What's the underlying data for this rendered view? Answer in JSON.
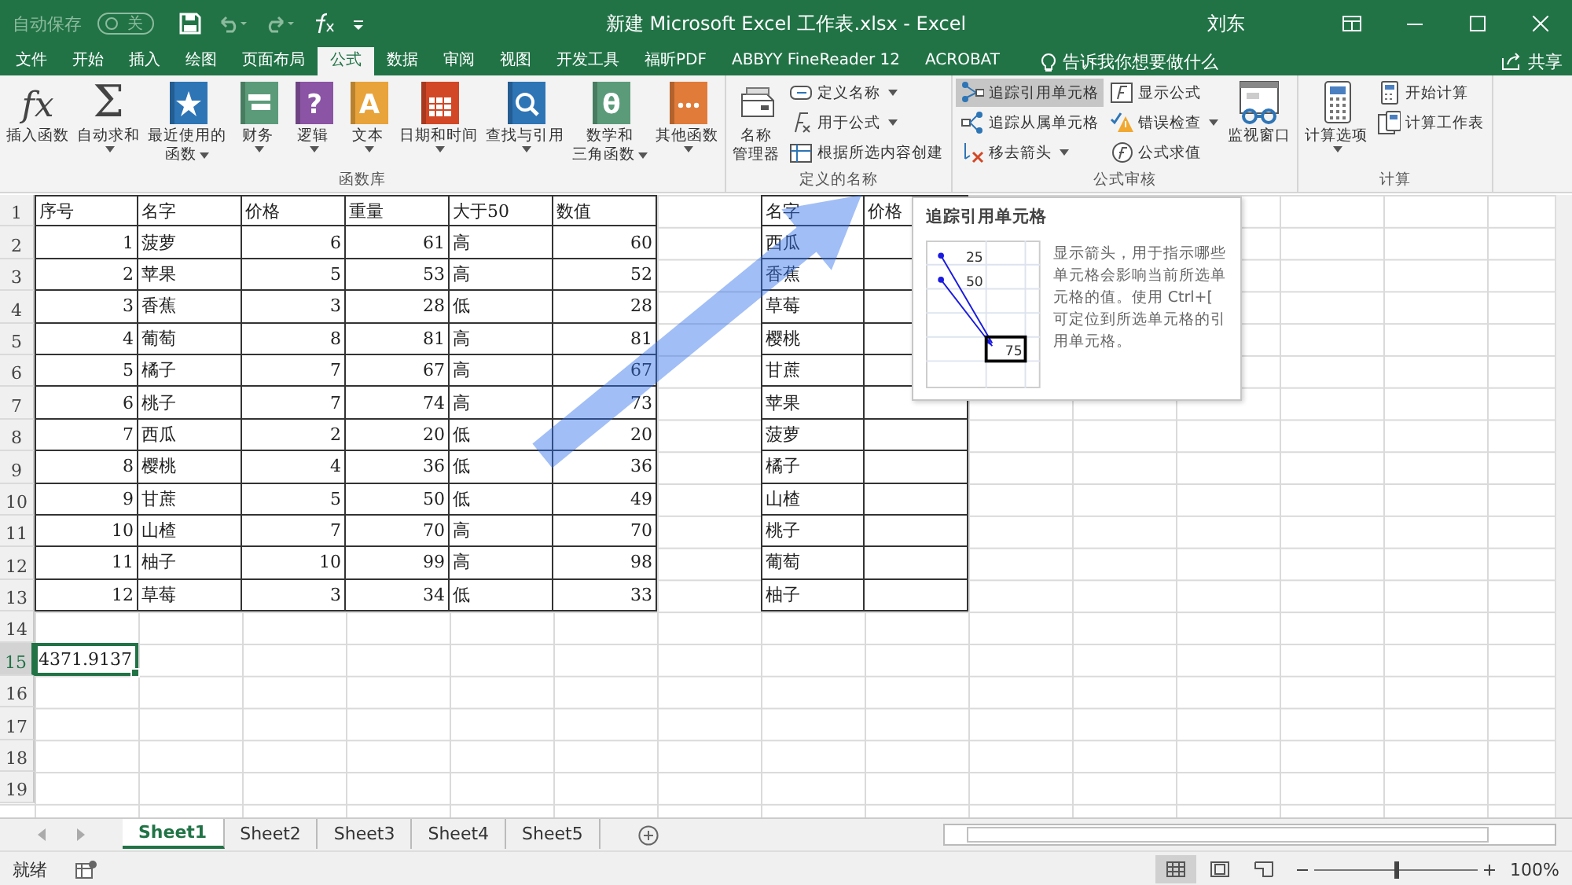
{
  "title_bar": {
    "autosave": {
      "label": "自动保存",
      "on": false,
      "state_text": "关"
    },
    "title": "新建 Microsoft Excel 工作表.xlsx  -  Excel",
    "user": "刘东"
  },
  "tabs": [
    {
      "label": "文件",
      "selected": false
    },
    {
      "label": "开始",
      "selected": false
    },
    {
      "label": "插入",
      "selected": false
    },
    {
      "label": "绘图",
      "selected": false
    },
    {
      "label": "页面布局",
      "selected": false
    },
    {
      "label": "公式",
      "selected": true
    },
    {
      "label": "数据",
      "selected": false
    },
    {
      "label": "审阅",
      "selected": false
    },
    {
      "label": "视图",
      "selected": false
    },
    {
      "label": "开发工具",
      "selected": false
    },
    {
      "label": "福昕PDF",
      "selected": false
    },
    {
      "label": "ABBYY FineReader 12",
      "selected": false
    },
    {
      "label": "ACROBAT",
      "selected": false
    }
  ],
  "tell_me": {
    "placeholder": "告诉我你想要做什么"
  },
  "share": {
    "label": "共享"
  },
  "ribbon": {
    "groups": [
      {
        "label": "函数库",
        "items": [
          {
            "kind": "big",
            "label": [
              "插入函数"
            ],
            "glyph": "fx",
            "dropdown": false
          },
          {
            "kind": "big",
            "label": [
              "自动求和"
            ],
            "glyph": "Σ",
            "dropdown": true
          },
          {
            "kind": "big",
            "label": [
              "最近使用的",
              "函数"
            ],
            "dropdown": true
          },
          {
            "kind": "big",
            "label": [
              "财务"
            ],
            "dropdown": true
          },
          {
            "kind": "big",
            "label": [
              "逻辑"
            ],
            "glyph": "?",
            "dropdown": true
          },
          {
            "kind": "big",
            "label": [
              "文本"
            ],
            "glyph": "A",
            "dropdown": true
          },
          {
            "kind": "big",
            "label": [
              "日期和时间"
            ],
            "dropdown": true
          },
          {
            "kind": "big",
            "label": [
              "查找与引用"
            ],
            "dropdown": true
          },
          {
            "kind": "big",
            "label": [
              "数学和",
              "三角函数"
            ],
            "glyph": "θ",
            "dropdown": true
          },
          {
            "kind": "big",
            "label": [
              "其他函数"
            ],
            "dropdown": true
          }
        ]
      },
      {
        "label": "定义的名称",
        "items": [
          {
            "kind": "big",
            "label": [
              "名称",
              "管理器"
            ],
            "dropdown": false
          },
          {
            "kind": "stack",
            "buttons": [
              {
                "label": "定义名称",
                "dropdown": true,
                "highlighted": false
              },
              {
                "label": "用于公式",
                "dropdown": true,
                "highlighted": false
              },
              {
                "label": "根据所选内容创建",
                "dropdown": false,
                "highlighted": false
              }
            ]
          }
        ]
      },
      {
        "label": "公式审核",
        "items": [
          {
            "kind": "stack",
            "buttons": [
              {
                "label": "追踪引用单元格",
                "dropdown": false,
                "highlighted": true
              },
              {
                "label": "追踪从属单元格",
                "dropdown": false,
                "highlighted": false
              },
              {
                "label": "移去箭头",
                "dropdown": true,
                "highlighted": false
              }
            ]
          },
          {
            "kind": "stack",
            "buttons": [
              {
                "label": "显示公式",
                "dropdown": false,
                "highlighted": false
              },
              {
                "label": "错误检查",
                "dropdown": true,
                "highlighted": false
              },
              {
                "label": "公式求值",
                "dropdown": false,
                "highlighted": false
              }
            ]
          },
          {
            "kind": "big",
            "label": [
              "监视窗口"
            ],
            "dropdown": false
          }
        ]
      },
      {
        "label": "计算",
        "items": [
          {
            "kind": "big",
            "label": [
              "计算选项"
            ],
            "dropdown": true
          },
          {
            "kind": "stack",
            "buttons": [
              {
                "label": "开始计算",
                "dropdown": false,
                "highlighted": false
              },
              {
                "label": "计算工作表",
                "dropdown": false,
                "highlighted": false
              }
            ]
          }
        ]
      }
    ]
  },
  "sheet": {
    "rows": [
      {
        "label": "1",
        "selected": false
      },
      {
        "label": "2",
        "selected": false
      },
      {
        "label": "3",
        "selected": false
      },
      {
        "label": "4",
        "selected": false
      },
      {
        "label": "5",
        "selected": false
      },
      {
        "label": "6",
        "selected": false
      },
      {
        "label": "7",
        "selected": false
      },
      {
        "label": "8",
        "selected": false
      },
      {
        "label": "9",
        "selected": false
      },
      {
        "label": "10",
        "selected": false
      },
      {
        "label": "11",
        "selected": false
      },
      {
        "label": "12",
        "selected": false
      },
      {
        "label": "13",
        "selected": false
      },
      {
        "label": "14",
        "selected": false
      },
      {
        "label": "15",
        "selected": true
      },
      {
        "label": "16",
        "selected": false
      },
      {
        "label": "17",
        "selected": false
      },
      {
        "label": "18",
        "selected": false
      },
      {
        "label": "19",
        "selected": false
      }
    ],
    "table_1": {
      "columns": [
        {
          "header": "序号",
          "kind": "number"
        },
        {
          "header": "名字",
          "kind": "text"
        },
        {
          "header": "价格",
          "kind": "number"
        },
        {
          "header": "重量",
          "kind": "number"
        },
        {
          "header": "大于50",
          "kind": "text"
        },
        {
          "header": "数值",
          "kind": "number"
        }
      ],
      "rows": [
        [
          "1",
          "菠萝",
          "6",
          "61",
          "高",
          "60"
        ],
        [
          "2",
          "苹果",
          "5",
          "53",
          "高",
          "52"
        ],
        [
          "3",
          "香蕉",
          "3",
          "28",
          "低",
          "28"
        ],
        [
          "4",
          "葡萄",
          "8",
          "81",
          "高",
          "81"
        ],
        [
          "5",
          "橘子",
          "7",
          "67",
          "高",
          "67"
        ],
        [
          "6",
          "桃子",
          "7",
          "74",
          "高",
          "73"
        ],
        [
          "7",
          "西瓜",
          "2",
          "20",
          "低",
          "20"
        ],
        [
          "8",
          "樱桃",
          "4",
          "36",
          "低",
          "36"
        ],
        [
          "9",
          "甘蔗",
          "5",
          "50",
          "低",
          "49"
        ],
        [
          "10",
          "山楂",
          "7",
          "70",
          "高",
          "70"
        ],
        [
          "11",
          "柚子",
          "10",
          "99",
          "高",
          "98"
        ],
        [
          "12",
          "草莓",
          "3",
          "34",
          "低",
          "33"
        ]
      ]
    },
    "table_2": {
      "columns": [
        {
          "header": "名字"
        },
        {
          "header": "价格"
        }
      ],
      "rows": [
        [
          "西瓜"
        ],
        [
          "香蕉"
        ],
        [
          "草莓"
        ],
        [
          "樱桃"
        ],
        [
          "甘蔗"
        ],
        [
          "苹果"
        ],
        [
          "菠萝"
        ],
        [
          "橘子"
        ],
        [
          "山楂"
        ],
        [
          "桃子"
        ],
        [
          "葡萄"
        ],
        [
          "柚子"
        ]
      ]
    },
    "active_cell": {
      "value": "4371.9137"
    }
  },
  "tooltip": {
    "title": "追踪引用单元格",
    "example_values": [
      "25",
      "50",
      "75"
    ],
    "description": "显示箭头，用于指示哪些单元格会影响当前所选单元格的值。使用 Ctrl+[ 可定位到所选单元格的引用单元格。"
  },
  "sheet_tabs": [
    {
      "label": "Sheet1",
      "selected": true
    },
    {
      "label": "Sheet2",
      "selected": false
    },
    {
      "label": "Sheet3",
      "selected": false
    },
    {
      "label": "Sheet4",
      "selected": false
    },
    {
      "label": "Sheet5",
      "selected": false
    }
  ],
  "status_bar": {
    "status": "就绪",
    "views": [
      {
        "selected": true
      },
      {
        "selected": false
      },
      {
        "selected": false
      }
    ],
    "zoom": {
      "level": 0.5,
      "reading": "100%"
    }
  }
}
